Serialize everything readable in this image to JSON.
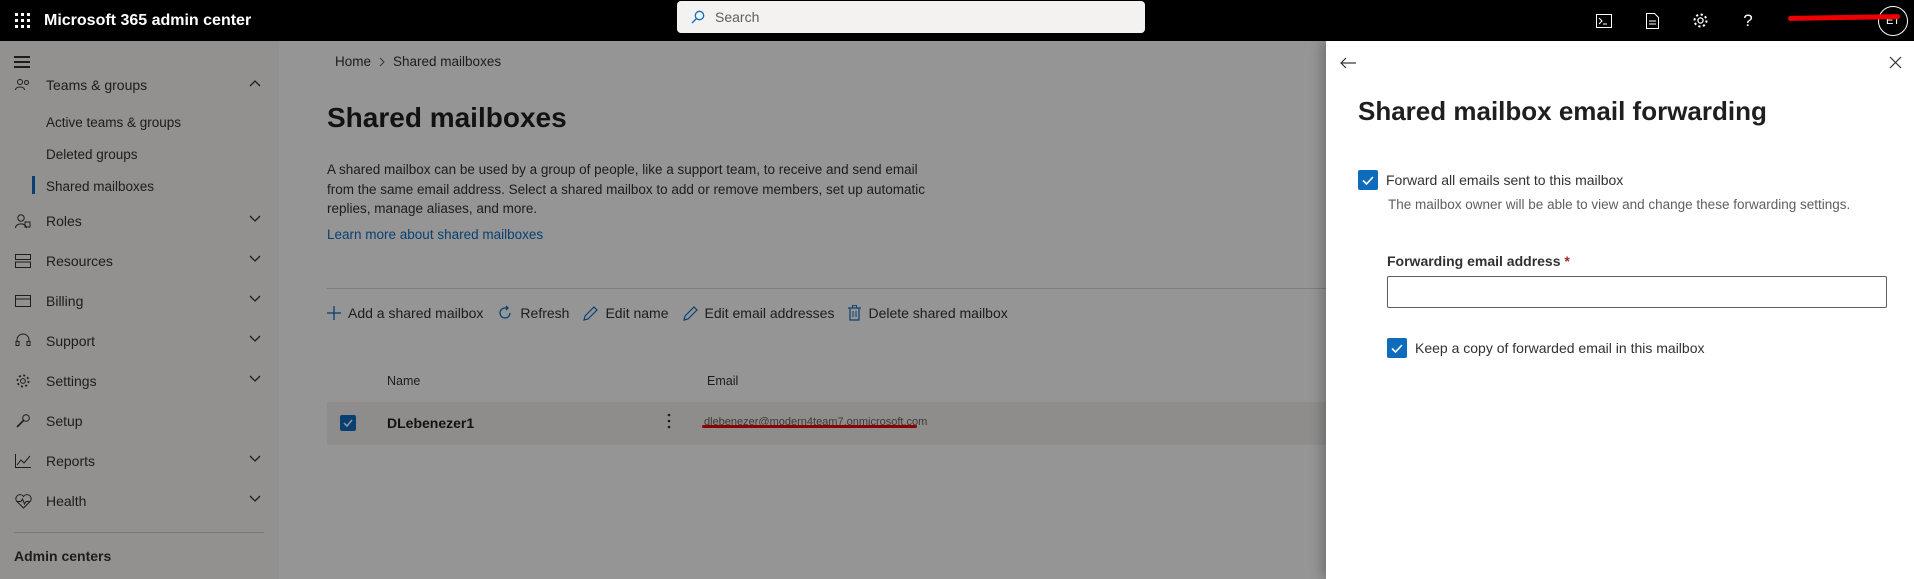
{
  "topbar": {
    "app_title": "Microsoft 365 admin center",
    "search_placeholder": "Search",
    "avatar_initials": "ET",
    "icons": [
      "waffle-icon",
      "terminal-icon",
      "document-icon",
      "gear-icon",
      "help-icon"
    ]
  },
  "nav": {
    "groups_label": "Teams & groups",
    "sub_items": [
      "Active teams & groups",
      "Deleted groups",
      "Shared mailboxes"
    ],
    "items": [
      {
        "label": "Roles",
        "icon": "roles-icon"
      },
      {
        "label": "Resources",
        "icon": "resources-icon"
      },
      {
        "label": "Billing",
        "icon": "billing-icon"
      },
      {
        "label": "Support",
        "icon": "support-icon"
      },
      {
        "label": "Settings",
        "icon": "gear-icon"
      },
      {
        "label": "Setup",
        "icon": "wrench-icon"
      },
      {
        "label": "Reports",
        "icon": "chart-icon"
      },
      {
        "label": "Health",
        "icon": "heart-icon"
      }
    ],
    "admin_centers": "Admin centers"
  },
  "main": {
    "breadcrumb": [
      "Home",
      "Shared mailboxes"
    ],
    "title": "Shared mailboxes",
    "description": "A shared mailbox can be used by a group of people, like a support team, to receive and send email from the same email address. Select a shared mailbox to add or remove members, set up automatic replies, manage aliases, and more.",
    "learn_more": "Learn more about shared mailboxes",
    "commands": [
      "Add a shared mailbox",
      "Refresh",
      "Edit name",
      "Edit email addresses",
      "Delete shared mailbox"
    ],
    "columns": [
      "Name",
      "Email"
    ],
    "rows": [
      {
        "name": "DLebenezer1",
        "email": "dlebenezer@modern4team7.onmicrosoft.com",
        "selected": true
      }
    ]
  },
  "panel": {
    "title": "Shared mailbox email forwarding",
    "forward_all_label": "Forward all emails sent to this mailbox",
    "forward_all_checked": true,
    "hint": "The mailbox owner will be able to view and change these forwarding settings.",
    "field_label": "Forwarding email address",
    "field_required_marker": "*",
    "field_value": "",
    "keep_copy_label": "Keep a copy of forwarded email in this mailbox",
    "keep_copy_checked": true
  },
  "colors": {
    "accent": "#0f6cbd",
    "topbar": "#000000",
    "redaction": "#e00000"
  }
}
